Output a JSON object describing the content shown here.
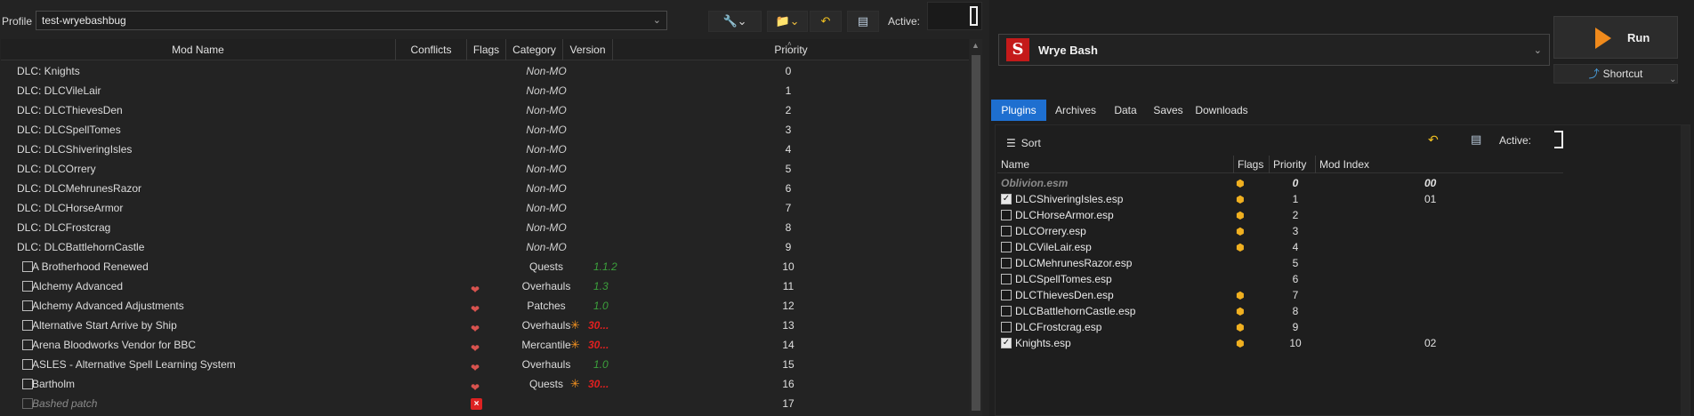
{
  "profile": {
    "label": "Profile",
    "value": "test-wryebashbug"
  },
  "toolbar_left": {
    "tools_icon": "wrench-screwdriver-icon",
    "folder_icon": "folder-icon",
    "undo_icon": "undo-arrow-icon",
    "hdd_icon": "drive-icon",
    "active_label": "Active:"
  },
  "mod_columns": {
    "name": "Mod Name",
    "conflicts": "Conflicts",
    "flags": "Flags",
    "category": "Category",
    "version": "Version",
    "priority": "Priority"
  },
  "mods": [
    {
      "name": "DLC: Knights",
      "category": "Non-MO",
      "version": "",
      "priority": "0",
      "checkbox": false,
      "flag": "",
      "nonmo": true
    },
    {
      "name": "DLC: DLCVileLair",
      "category": "Non-MO",
      "version": "",
      "priority": "1",
      "checkbox": false,
      "flag": "",
      "nonmo": true
    },
    {
      "name": "DLC: DLCThievesDen",
      "category": "Non-MO",
      "version": "",
      "priority": "2",
      "checkbox": false,
      "flag": "",
      "nonmo": true
    },
    {
      "name": "DLC: DLCSpellTomes",
      "category": "Non-MO",
      "version": "",
      "priority": "3",
      "checkbox": false,
      "flag": "",
      "nonmo": true
    },
    {
      "name": "DLC: DLCShiveringIsles",
      "category": "Non-MO",
      "version": "",
      "priority": "4",
      "checkbox": false,
      "flag": "",
      "nonmo": true
    },
    {
      "name": "DLC: DLCOrrery",
      "category": "Non-MO",
      "version": "",
      "priority": "5",
      "checkbox": false,
      "flag": "",
      "nonmo": true
    },
    {
      "name": "DLC: DLCMehrunesRazor",
      "category": "Non-MO",
      "version": "",
      "priority": "6",
      "checkbox": false,
      "flag": "",
      "nonmo": true
    },
    {
      "name": "DLC: DLCHorseArmor",
      "category": "Non-MO",
      "version": "",
      "priority": "7",
      "checkbox": false,
      "flag": "",
      "nonmo": true
    },
    {
      "name": "DLC: DLCFrostcrag",
      "category": "Non-MO",
      "version": "",
      "priority": "8",
      "checkbox": false,
      "flag": "",
      "nonmo": true
    },
    {
      "name": "DLC: DLCBattlehornCastle",
      "category": "Non-MO",
      "version": "",
      "priority": "9",
      "checkbox": false,
      "flag": "",
      "nonmo": true
    },
    {
      "name": "A Brotherhood Renewed",
      "category": "Quests",
      "version": "1.1.2",
      "priority": "10",
      "checkbox": true,
      "flag": "",
      "nonmo": false,
      "warn": false
    },
    {
      "name": "Alchemy Advanced",
      "category": "Overhauls",
      "version": "1.3",
      "priority": "11",
      "checkbox": true,
      "flag": "heart",
      "nonmo": false,
      "warn": false
    },
    {
      "name": "Alchemy Advanced Adjustments",
      "category": "Patches",
      "version": "1.0",
      "priority": "12",
      "checkbox": true,
      "flag": "heart",
      "nonmo": false,
      "warn": false
    },
    {
      "name": "Alternative Start Arrive by Ship",
      "category": "Overhauls",
      "version": "30...",
      "priority": "13",
      "checkbox": true,
      "flag": "heart",
      "nonmo": false,
      "warn": true
    },
    {
      "name": "Arena Bloodworks Vendor for BBC",
      "category": "Mercantile",
      "version": "30...",
      "priority": "14",
      "checkbox": true,
      "flag": "heart",
      "nonmo": false,
      "warn": true
    },
    {
      "name": "ASLES - Alternative Spell Learning System",
      "category": "Overhauls",
      "version": "1.0",
      "priority": "15",
      "checkbox": true,
      "flag": "heart",
      "nonmo": false,
      "warn": false
    },
    {
      "name": "Bartholm",
      "category": "Quests",
      "version": "30...",
      "priority": "16",
      "checkbox": true,
      "flag": "heart",
      "nonmo": false,
      "warn": true
    },
    {
      "name": "Bashed patch",
      "category": "",
      "version": "",
      "priority": "17",
      "checkbox": true,
      "flag": "x",
      "nonmo": false,
      "warn": false,
      "bashed": true
    }
  ],
  "app": {
    "name": "Wrye Bash",
    "logo_glyph": "S",
    "run_label": "Run",
    "shortcut_label": "Shortcut"
  },
  "tabs": [
    "Plugins",
    "Archives",
    "Data",
    "Saves",
    "Downloads"
  ],
  "active_tab": "Plugins",
  "plugins_toolbar": {
    "sort_label": "Sort",
    "active_label": "Active:"
  },
  "plugin_columns": {
    "name": "Name",
    "flags": "Flags",
    "priority": "Priority",
    "mod_index": "Mod Index"
  },
  "plugins": [
    {
      "name": "Oblivion.esm",
      "priority": "0",
      "mod_index": "00",
      "checked": null,
      "flag": true,
      "master": true
    },
    {
      "name": "DLCShiveringIsles.esp",
      "priority": "1",
      "mod_index": "01",
      "checked": true,
      "flag": true
    },
    {
      "name": "DLCHorseArmor.esp",
      "priority": "2",
      "mod_index": "",
      "checked": false,
      "flag": true
    },
    {
      "name": "DLCOrrery.esp",
      "priority": "3",
      "mod_index": "",
      "checked": false,
      "flag": true
    },
    {
      "name": "DLCVileLair.esp",
      "priority": "4",
      "mod_index": "",
      "checked": false,
      "flag": true
    },
    {
      "name": "DLCMehrunesRazor.esp",
      "priority": "5",
      "mod_index": "",
      "checked": false,
      "flag": false
    },
    {
      "name": "DLCSpellTomes.esp",
      "priority": "6",
      "mod_index": "",
      "checked": false,
      "flag": false
    },
    {
      "name": "DLCThievesDen.esp",
      "priority": "7",
      "mod_index": "",
      "checked": false,
      "flag": true
    },
    {
      "name": "DLCBattlehornCastle.esp",
      "priority": "8",
      "mod_index": "",
      "checked": false,
      "flag": true
    },
    {
      "name": "DLCFrostcrag.esp",
      "priority": "9",
      "mod_index": "",
      "checked": false,
      "flag": true
    },
    {
      "name": "Knights.esp",
      "priority": "10",
      "mod_index": "02",
      "checked": true,
      "flag": true
    }
  ],
  "colors": {
    "accent_tab": "#1e6fd0",
    "run_play": "#f08a1c",
    "version_ok": "#3ca03c",
    "version_warn": "#e02020",
    "logo": "#c41a1a"
  }
}
